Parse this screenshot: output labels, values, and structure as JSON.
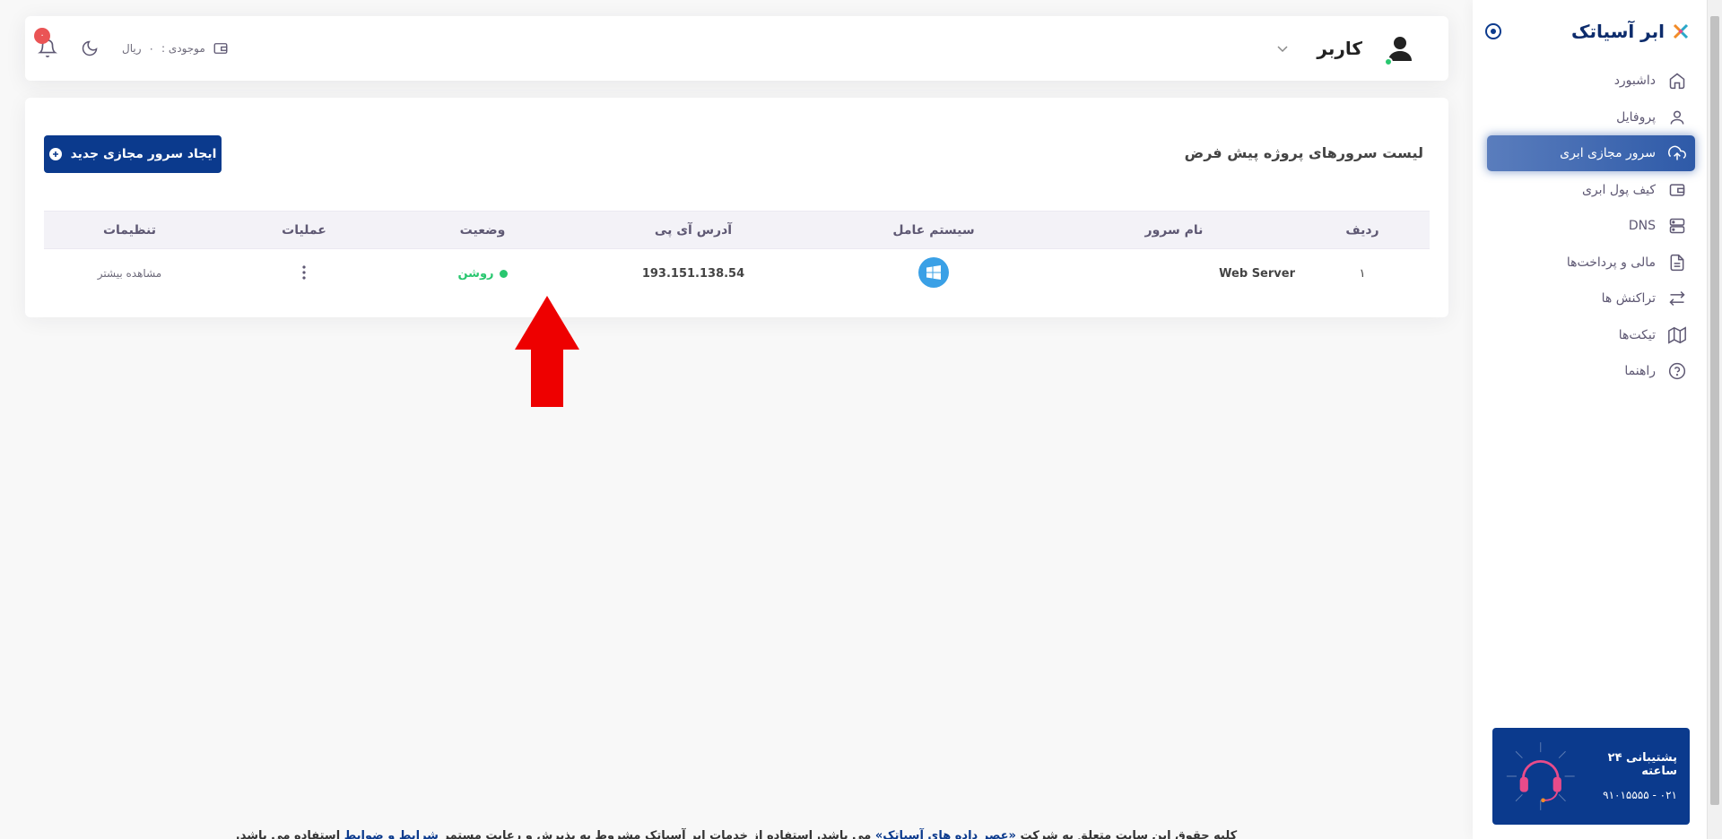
{
  "brand": {
    "name": "ابر آسیاتک"
  },
  "sidebar": {
    "items": [
      {
        "label": "داشبورد",
        "icon": "home-icon"
      },
      {
        "label": "پروفایل",
        "icon": "user-icon"
      },
      {
        "label": "سرور مجازی ابری",
        "icon": "cloud-upload-icon",
        "active": true
      },
      {
        "label": "کیف پول ابری",
        "icon": "wallet-icon"
      },
      {
        "label": "DNS",
        "icon": "server-icon"
      },
      {
        "label": "مالی و پرداخت‌ها",
        "icon": "file-text-icon"
      },
      {
        "label": "تراکنش ها",
        "icon": "repeat-icon"
      },
      {
        "label": "تیکت‌ها",
        "icon": "map-icon"
      },
      {
        "label": "راهنما",
        "icon": "help-circle-icon"
      }
    ],
    "support": {
      "title": "پشتیبانی ۲۴ ساعته",
      "phone": "۰۲۱ - ۹۱۰۱۵۵۵۵"
    }
  },
  "header": {
    "user_name": "کاربر",
    "notifications_count": "۰",
    "balance_label": "موجودی :",
    "balance_value": "۰",
    "balance_unit": "ریال"
  },
  "main": {
    "title": "لیست سرورهای پروژه پیش فرض",
    "create_button": "ایجاد سرور مجازی جدید",
    "table": {
      "headers": [
        "ردیف",
        "نام سرور",
        "سیستم عامل",
        "آدرس آی پی",
        "وضعیت",
        "عملیات",
        "تنظیمات"
      ],
      "rows": [
        {
          "index": "۱",
          "name": "Web Server",
          "os": "windows-icon",
          "ip": "193.151.138.54",
          "status": "روشن",
          "settings": "مشاهده بیشتر"
        }
      ]
    }
  },
  "footer": {
    "text_1": "کلیه حقوق این سایت متعلق به شرکت",
    "company": "«عصر داده های آسیاتک»",
    "text_2": "می باشد. استفاده از خدمات ابر آسیاتک مشروط به پذیرش و رعایت مستمر",
    "terms": "شرایط و ضوابط",
    "text_3": "استفاده می باشد."
  },
  "colors": {
    "primary": "#0b3a8d",
    "active_gradient": "#2e5aa8",
    "success": "#28c76f",
    "danger": "#ea5455",
    "arrow": "#ee0000"
  }
}
